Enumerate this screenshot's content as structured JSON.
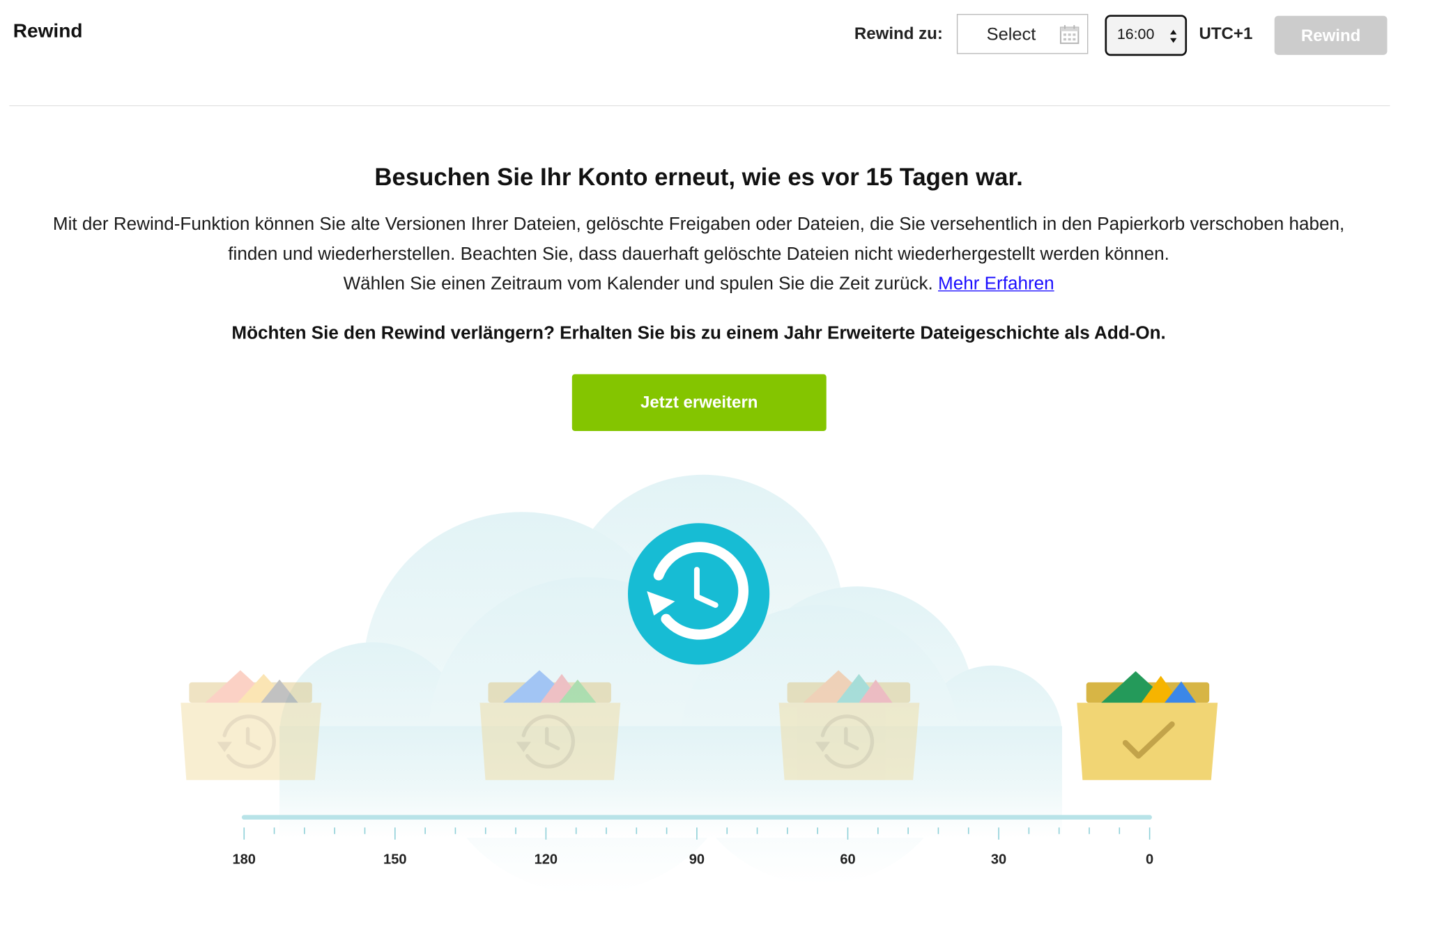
{
  "header": {
    "title": "Rewind",
    "rewind_to_label": "Rewind zu:",
    "date_placeholder": "Select",
    "time_value": "16:00",
    "timezone": "UTC+1",
    "rewind_button": "Rewind"
  },
  "main": {
    "headline": "Besuchen Sie Ihr Konto erneut, wie es vor 15 Tagen war.",
    "description_line1": "Mit der Rewind-Funktion können Sie alte Versionen Ihrer Dateien, gelöschte Freigaben oder Dateien, die Sie versehentlich in den Papierkorb verschoben haben,",
    "description_line2": "finden und wiederherstellen. Beachten Sie, dass dauerhaft gelöschte Dateien nicht wiederhergestellt werden können.",
    "description_line3": "Wählen Sie einen Zeitraum vom Kalender und spulen Sie die Zeit zurück.",
    "learn_more": "Mehr Erfahren",
    "upsell": "Möchten Sie den Rewind verlängern? Erhalten Sie bis zu einem Jahr Erweiterte Dateigeschichte als Add-On.",
    "cta_button": "Jetzt erweitern"
  },
  "timeline": {
    "labels": [
      "180",
      "150",
      "120",
      "90",
      "60",
      "30",
      "0"
    ]
  },
  "colors": {
    "accent_green": "#84c500",
    "history_teal": "#17bcd4",
    "folder_yellow": "#f1d574",
    "folder_faded": "#f6ecc8",
    "timeline_teal": "#b8e3e8",
    "link_blue": "#1a0dff"
  },
  "icons": [
    "calendar-icon",
    "spinner-icon",
    "history-icon",
    "folder-history-icon",
    "folder-check-icon"
  ]
}
